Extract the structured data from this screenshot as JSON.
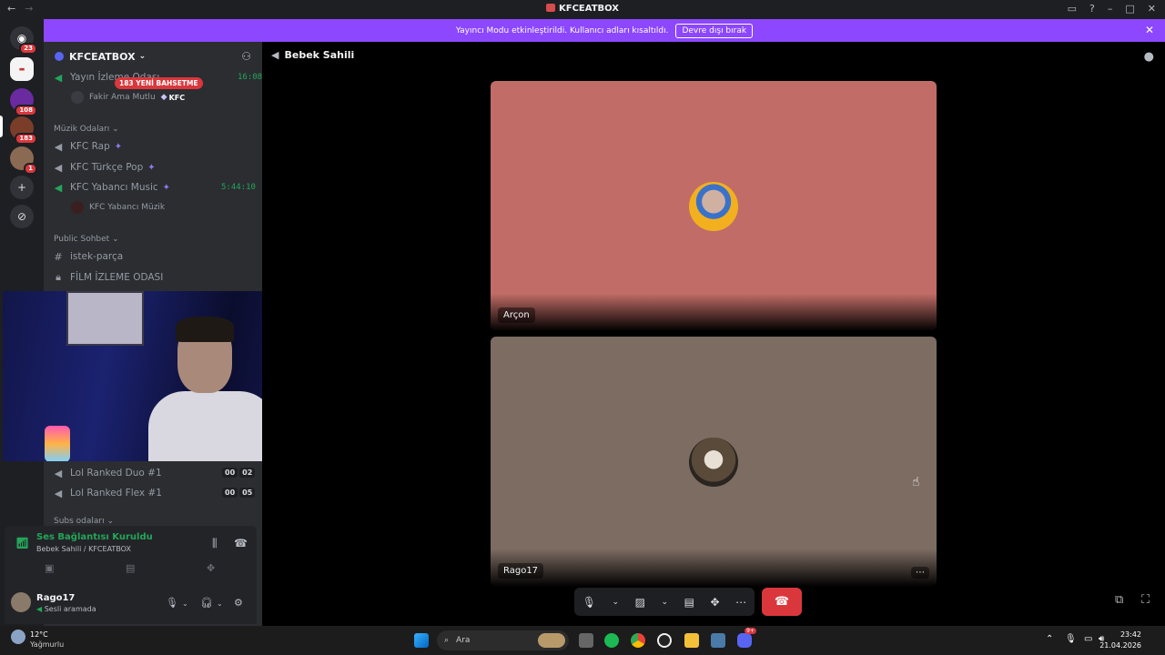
{
  "window": {
    "title": "KFCEATBOX"
  },
  "banner": {
    "message": "Yayıncı Modu etkinleştirildi. Kullanıcı adları kısaltıldı.",
    "button": "Devre dışı bırak"
  },
  "rail": {
    "badges": [
      "23",
      "108",
      "183",
      "1"
    ]
  },
  "guild": {
    "name": "KFCEATBOX",
    "mention_pill": "183 YENİ BAHSETME",
    "channels_top": {
      "name": "Yayın İzleme Odası",
      "time": "16:08",
      "user": "Fakir Ama Mutlu",
      "tag": "KFC"
    },
    "category_music": "Müzik Odaları",
    "music": [
      {
        "name": "KFC Rap"
      },
      {
        "name": "KFC Türkçe Pop"
      },
      {
        "name": "KFC Yabancı Music",
        "time": "5:44:10"
      }
    ],
    "music_user": "KFC Yabancı Müzik",
    "category_public": "Public Sohbet",
    "text_channel": "istek-parça",
    "locked_channel": "FİLM İZLEME ODASI",
    "ranked": [
      {
        "name": "Lol Ranked Duo #1",
        "a": "00",
        "b": "02"
      },
      {
        "name": "Lol Ranked Flex #1",
        "a": "00",
        "b": "05"
      }
    ],
    "category_subs": "Subs odaları"
  },
  "voice": {
    "status": "Ses Bağlantısı Kuruldu",
    "location": "Bebek Sahili / KFCEATBOX"
  },
  "user": {
    "name": "Rago17",
    "status": "Sesli aramada"
  },
  "stage": {
    "channel": "Bebek Sahili",
    "tiles": [
      {
        "name": "Arçon",
        "color": "#c16c66"
      },
      {
        "name": "Rago17",
        "color": "#7c6c62"
      }
    ]
  },
  "taskbar": {
    "temp": "12°C",
    "weather": "Yağmurlu",
    "search": "Ara",
    "time": "23:42",
    "date": "21.04.2026",
    "discord_badge": "9+"
  },
  "colors": {
    "accent": "#8c47ff",
    "danger": "#da373c",
    "online": "#23a55a"
  }
}
